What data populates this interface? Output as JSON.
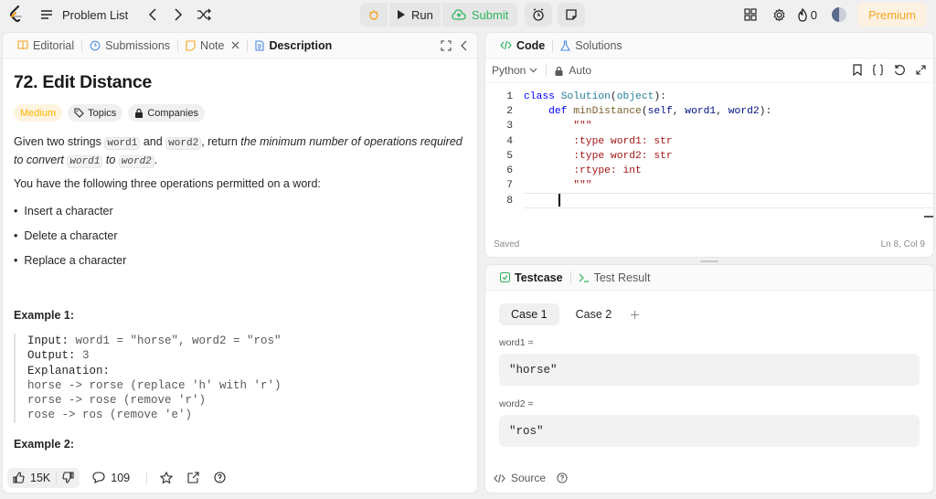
{
  "topbar": {
    "problem_list": "Problem List",
    "run": "Run",
    "submit": "Submit",
    "streak": "0",
    "premium": "Premium"
  },
  "left": {
    "tabs": [
      "Editorial",
      "Submissions",
      "Note",
      "Description"
    ],
    "title": "72. Edit Distance",
    "difficulty": "Medium",
    "topics": "Topics",
    "companies": "Companies",
    "p1_a": "Given two strings ",
    "p1_code1": "word1",
    "p1_and": " and ",
    "p1_code2": "word2",
    "p1_b": ", return ",
    "p1_em": "the minimum number of operations required to convert",
    "p1_code3": "word1",
    "p1_to": " to ",
    "p1_code4": "word2",
    "p1_end": ".",
    "p2": "You have the following three operations permitted on a word:",
    "ops": [
      "Insert a character",
      "Delete a character",
      "Replace a character"
    ],
    "example1_title": "Example 1:",
    "ex1": {
      "input_label": "Input:",
      "input_value": " word1 = \"horse\", word2 = \"ros\"",
      "output_label": "Output:",
      "output_value": " 3",
      "explanation_label": "Explanation:",
      "lines": [
        "horse -> rorse (replace 'h' with 'r')",
        "rorse -> rose (remove 'r')",
        "rose -> ros (remove 'e')"
      ]
    },
    "example2_title": "Example 2:",
    "likes": "15K",
    "comments": "109"
  },
  "code": {
    "tabs": [
      "Code",
      "Solutions"
    ],
    "language": "Python",
    "auto": "Auto",
    "status": "Saved",
    "cursor": "Ln 8, Col 9"
  },
  "testcase": {
    "tabs": [
      "Testcase",
      "Test Result"
    ],
    "cases": [
      "Case 1",
      "Case 2"
    ],
    "word1_label": "word1 =",
    "word1_value": "\"horse\"",
    "word2_label": "word2 =",
    "word2_value": "\"ros\"",
    "source": "Source"
  },
  "colors": {
    "accent": "#2db55d",
    "medium": "#ffb800",
    "premium": "#f5a623"
  }
}
